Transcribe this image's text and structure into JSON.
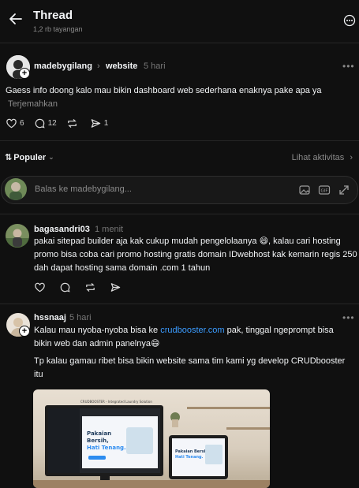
{
  "header": {
    "title": "Thread",
    "views": "1,2 rb tayangan"
  },
  "post": {
    "username": "madebygilang",
    "separator": "›",
    "topic": "website",
    "time": "5 hari",
    "text": "Gaess info doong kalo mau bikin dashboard web sederhana enaknya pake apa ya",
    "translate": "Terjemahkan",
    "likes": "6",
    "comments": "12",
    "shares": "1"
  },
  "sort": {
    "label": "Populer",
    "activity": "Lihat aktivitas"
  },
  "reply_input": {
    "placeholder": "Balas ke madebygilang..."
  },
  "replies": [
    {
      "username": "bagasandri03",
      "time": "1 menit",
      "text": "pakai sitepad builder aja kak cukup mudah pengelolaanya 😄, kalau cari hosting promo bisa coba cari promo hosting gratis domain IDwebhost kak kemarin regis 250 dah dapat hosting sama domain .com 1 tahun"
    },
    {
      "username": "hssnaaj",
      "time": "5 hari",
      "text_before": "Kalau mau nyoba-nyoba bisa ke ",
      "link": "crudbooster.com",
      "text_after": " pak, tinggal ngeprompt bisa bikin web dan admin panelnya😄",
      "text2": "Tp kalau gamau ribet bisa bikin website sama tim kami yg develop CRUDbooster itu"
    }
  ],
  "media": {
    "banner": "CRUDBOOSTER - Integrated Laundry Solution",
    "headline_1": "Pakaian",
    "headline_2": "Bersih,",
    "headline_3": "Hati Tenang.",
    "tablet_headline_1": "Pakaian Bersih,",
    "tablet_headline_2": "Hati Tenang."
  },
  "colors": {
    "background": "#101010",
    "link": "#3b9cff",
    "muted": "#8a8a8a",
    "divider": "#262626"
  }
}
